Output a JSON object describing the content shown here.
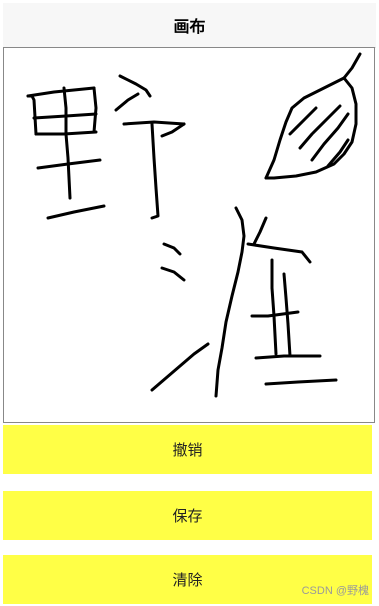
{
  "header": {
    "title": "画布"
  },
  "canvas": {
    "drawing_description": "handwritten strokes",
    "stroke_color": "#000000"
  },
  "actions": {
    "undo_label": "撤销",
    "save_label": "保存",
    "clear_label": "清除"
  },
  "colors": {
    "button_bg": "#ffff46",
    "header_bg": "#f7f7f7"
  },
  "watermark": {
    "text": "CSDN @野槐"
  }
}
